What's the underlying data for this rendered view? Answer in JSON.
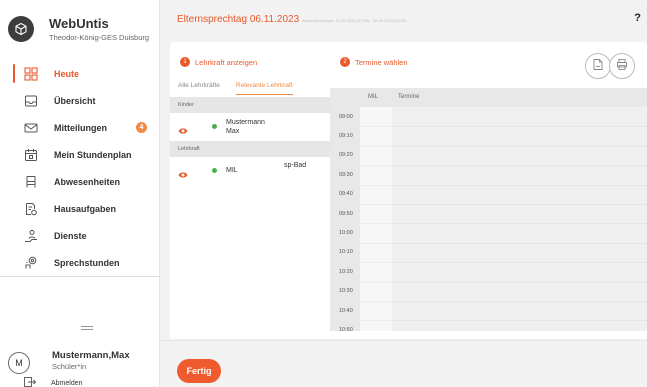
{
  "brand": {
    "title": "WebUntis",
    "subtitle": "Theodor-König-GES Duisburg"
  },
  "sidebar": {
    "items": [
      {
        "label": "Heute",
        "icon": "grid-icon",
        "active": true
      },
      {
        "label": "Übersicht",
        "icon": "inbox-icon",
        "active": false
      },
      {
        "label": "Mitteilungen",
        "icon": "mail-icon",
        "active": false,
        "badge": "4"
      },
      {
        "label": "Mein Stundenplan",
        "icon": "calendar-icon",
        "active": false
      },
      {
        "label": "Abwesenheiten",
        "icon": "bed-icon",
        "active": false
      },
      {
        "label": "Hausaufgaben",
        "icon": "homework-icon",
        "active": false
      },
      {
        "label": "Dienste",
        "icon": "person-service-icon",
        "active": false
      },
      {
        "label": "Sprechstunden",
        "icon": "consultation-icon",
        "active": false
      }
    ]
  },
  "user": {
    "initial": "M",
    "name": "Mustermann,Max",
    "role": "Schüler*in",
    "logout_label": "Abmelden"
  },
  "header": {
    "title": "Elternsprechtag 06.11.2023",
    "subtitle": "Anmeldezeitraum: 21.09.2023 (07:00) - 30.09.2023 (16:00)",
    "help": "?"
  },
  "steps": {
    "step1": {
      "num": "1",
      "label": "Lehrkraft anzeigen"
    },
    "step2": {
      "num": "2",
      "label": "Termine wählen"
    }
  },
  "subtabs": {
    "all": "Alle Lehrkräfte",
    "relevant": "Relevante Lehrkraft"
  },
  "list": {
    "section_children": "Kinder",
    "child_name": "Mustermann Max",
    "section_teacher": "Lehrkraft",
    "teacher_name": "MIL",
    "teacher_room": "sp-Bad"
  },
  "grid": {
    "col_teacher": "MIL",
    "col_termine": "Termine",
    "times": [
      "09:00",
      "09:10",
      "09:20",
      "09:30",
      "09:40",
      "09:50",
      "10:00",
      "10:10",
      "10:20",
      "10:30",
      "10:40",
      "10:50"
    ]
  },
  "footer": {
    "done_label": "Fertig"
  },
  "colors": {
    "accent": "#e9592a",
    "badge": "#f08b45",
    "status_green": "#4cae4c"
  }
}
